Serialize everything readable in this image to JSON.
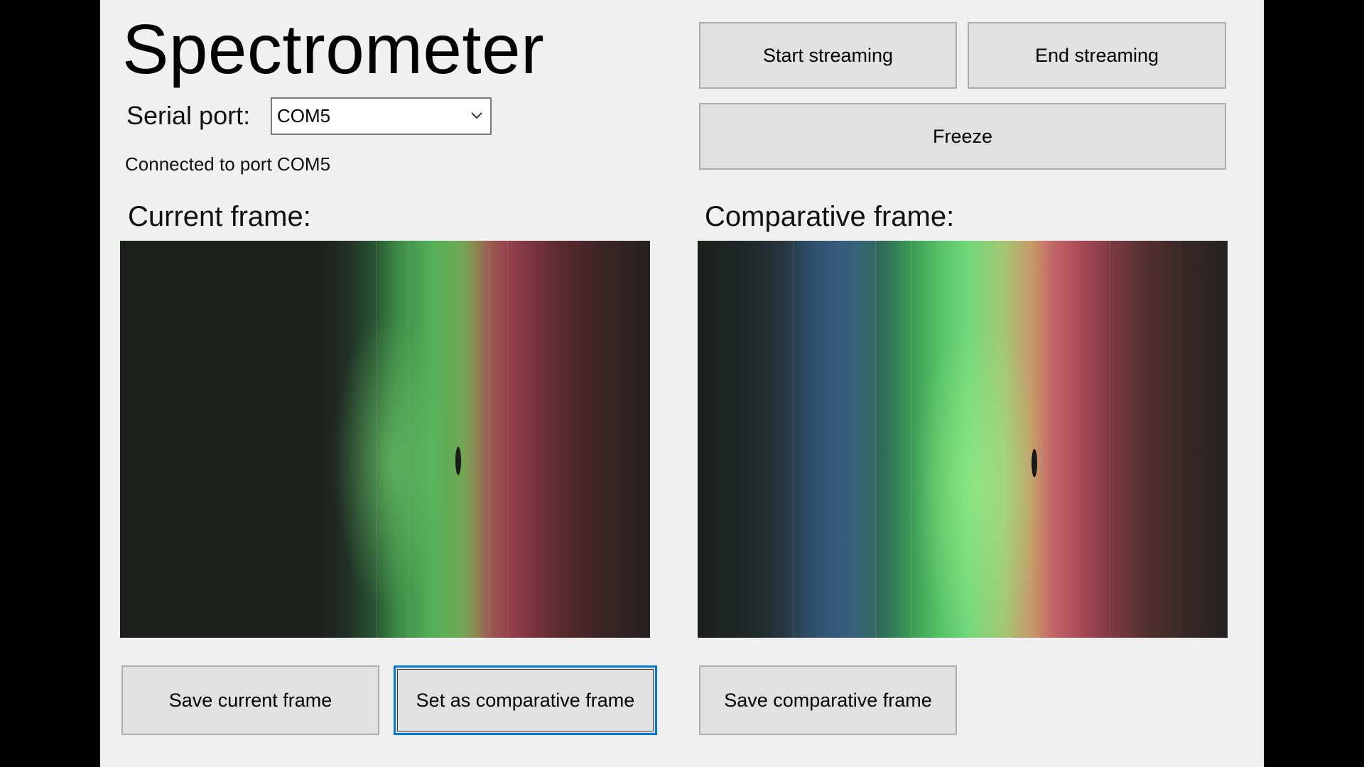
{
  "app": {
    "title": "Spectrometer",
    "serial_port": {
      "label": "Serial port:",
      "value": "COM5"
    },
    "status": "Connected to port COM5",
    "buttons": {
      "start_streaming": "Start streaming",
      "end_streaming": "End streaming",
      "freeze": "Freeze",
      "save_current": "Save current frame",
      "set_comparative": "Set as comparative frame",
      "save_comparative": "Save comparative frame"
    },
    "frames": {
      "current_label": "Current frame:",
      "comparative_label": "Comparative frame:"
    },
    "focused_button": "set_comparative",
    "colors": {
      "window_bg": "#f0f0f0",
      "button_bg": "#e1e1e1",
      "focus_border": "#0078d7"
    },
    "icons": {
      "dropdown": "chevron-down-icon"
    }
  }
}
